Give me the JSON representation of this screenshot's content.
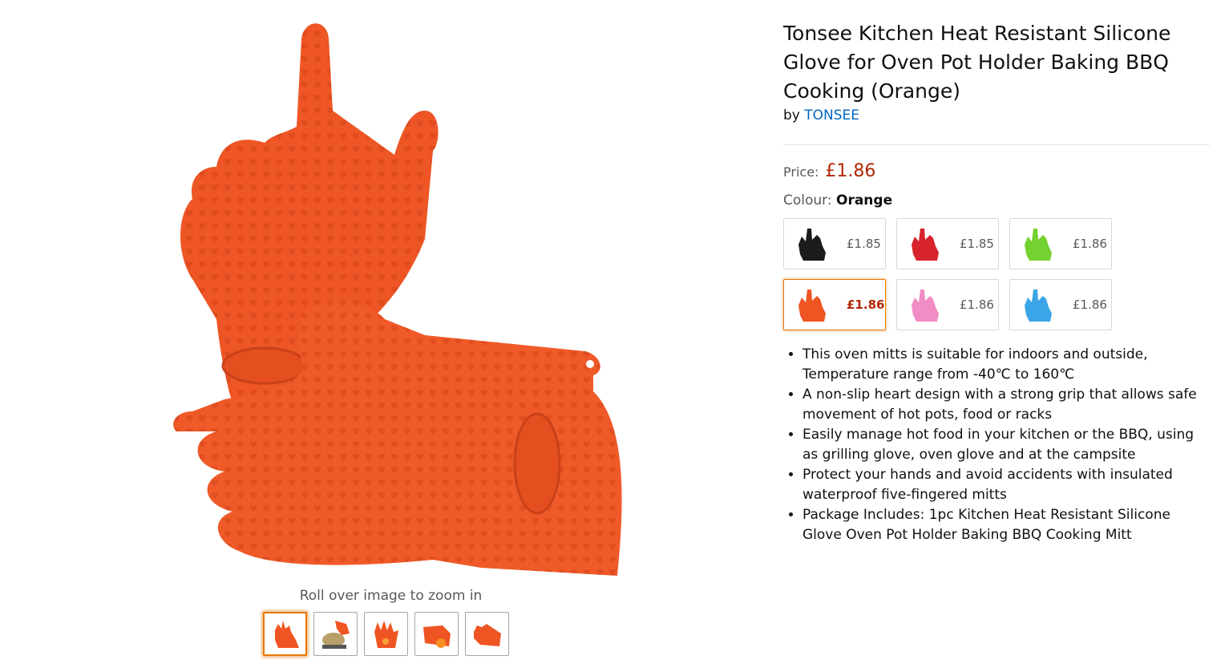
{
  "product": {
    "title": "Tonsee Kitchen Heat Resistant Silicone Glove for Oven Pot Holder Baking BBQ Cooking (Orange)",
    "by_prefix": "by",
    "brand": "TONSEE",
    "price_label": "Price:",
    "price": "£1.86",
    "colour_label": "Colour:",
    "colour_value": "Orange"
  },
  "gallery": {
    "zoom_hint": "Roll over image to zoom in",
    "main_image_icon": "orange-silicone-gloves-image",
    "thumbnails": [
      {
        "icon": "orange-glove-thumbnail",
        "selected": true
      },
      {
        "icon": "glove-with-pot-thumbnail",
        "selected": false
      },
      {
        "icon": "glove-flat-thumbnail",
        "selected": false
      },
      {
        "icon": "glove-holding-fruit-thumbnail",
        "selected": false
      },
      {
        "icon": "glove-side-thumbnail",
        "selected": false
      }
    ]
  },
  "swatches": [
    {
      "colour": "#1b1b1b",
      "price": "£1.85",
      "selected": false
    },
    {
      "colour": "#d7232c",
      "price": "£1.85",
      "selected": false
    },
    {
      "colour": "#74d230",
      "price": "£1.86",
      "selected": false
    },
    {
      "colour": "#ef5522",
      "price": "£1.86",
      "selected": true
    },
    {
      "colour": "#f28cc4",
      "price": "£1.86",
      "selected": false
    },
    {
      "colour": "#3aa6e8",
      "price": "£1.86",
      "selected": false
    }
  ],
  "bullets": [
    "This oven mitts is suitable for indoors and outside, Temperature range from -40℃ to 160℃",
    "A non-slip heart design with a strong grip that allows safe movement of hot pots, food or racks",
    "Easily manage hot food in your kitchen or the BBQ, using as grilling glove, oven glove and at the campsite",
    "Protect your hands and avoid accidents with insulated waterproof five-fingered mitts",
    "Package Includes: 1pc Kitchen Heat Resistant Silicone Glove Oven Pot Holder Baking BBQ Cooking Mitt"
  ],
  "colors": {
    "accent_orange": "#e77600",
    "glove_orange": "#ef5522",
    "price_red": "#b12704",
    "link_blue": "#0066c0"
  }
}
